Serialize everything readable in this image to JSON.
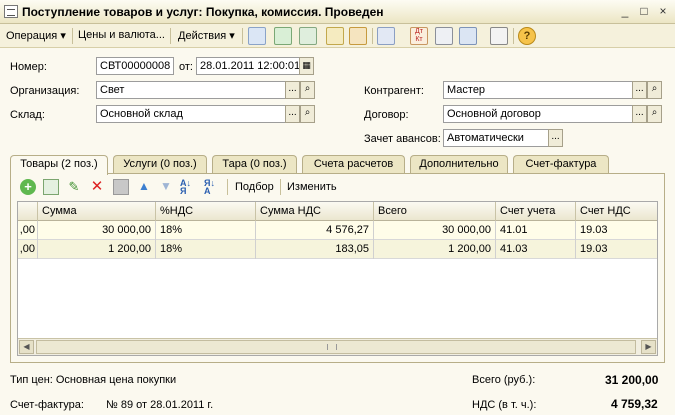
{
  "window": {
    "title": "Поступление товаров и услуг: Покупка, комиссия. Проведен",
    "controls": [
      "_",
      "□",
      "×"
    ]
  },
  "toolbar": {
    "operation": "Операция ▾",
    "prices": "Цены и валюта...",
    "actions": "Действия ▾"
  },
  "form": {
    "number_label": "Номер:",
    "number_value": "СВТ00000008",
    "date_label": "от:",
    "date_value": "28.01.2011 12:00:01",
    "org_label": "Организация:",
    "org_value": "Свет",
    "warehouse_label": "Склад:",
    "warehouse_value": "Основной склад",
    "contractor_label": "Контрагент:",
    "contractor_value": "Мастер",
    "contract_label": "Договор:",
    "contract_value": "Основной договор",
    "advance_label": "Зачет авансов:",
    "advance_value": "Автоматически",
    "select_btn": "...",
    "open_btn": "🔍"
  },
  "tabs": [
    {
      "label": "Товары (2 поз.)"
    },
    {
      "label": "Услуги (0 поз.)"
    },
    {
      "label": "Тара (0 поз.)"
    },
    {
      "label": "Счета расчетов"
    },
    {
      "label": "Дополнительно"
    },
    {
      "label": "Счет-фактура"
    }
  ],
  "panel_toolbar": {
    "selection": "Подбор",
    "change": "Изменить"
  },
  "table": {
    "columns": [
      "",
      "Сумма",
      "%НДС",
      "Сумма НДС",
      "Всего",
      "Счет учета",
      "Счет НДС"
    ],
    "rows": [
      [
        ",00",
        "30 000,00",
        "18%",
        "4 576,27",
        "30 000,00",
        "41.01",
        "19.03"
      ],
      [
        ",00",
        "1 200,00",
        "18%",
        "183,05",
        "1 200,00",
        "41.03",
        "19.03"
      ]
    ]
  },
  "footer": {
    "price_type": "Тип цен: Основная цена покупки",
    "total_label": "Всего (руб.):",
    "total_value": "31 200,00",
    "invoice_label": "Счет-фактура:",
    "invoice_value": "№ 89 от 28.01.2011 г.",
    "vat_label": "НДС (в т. ч.):",
    "vat_value": "4 759,32"
  }
}
